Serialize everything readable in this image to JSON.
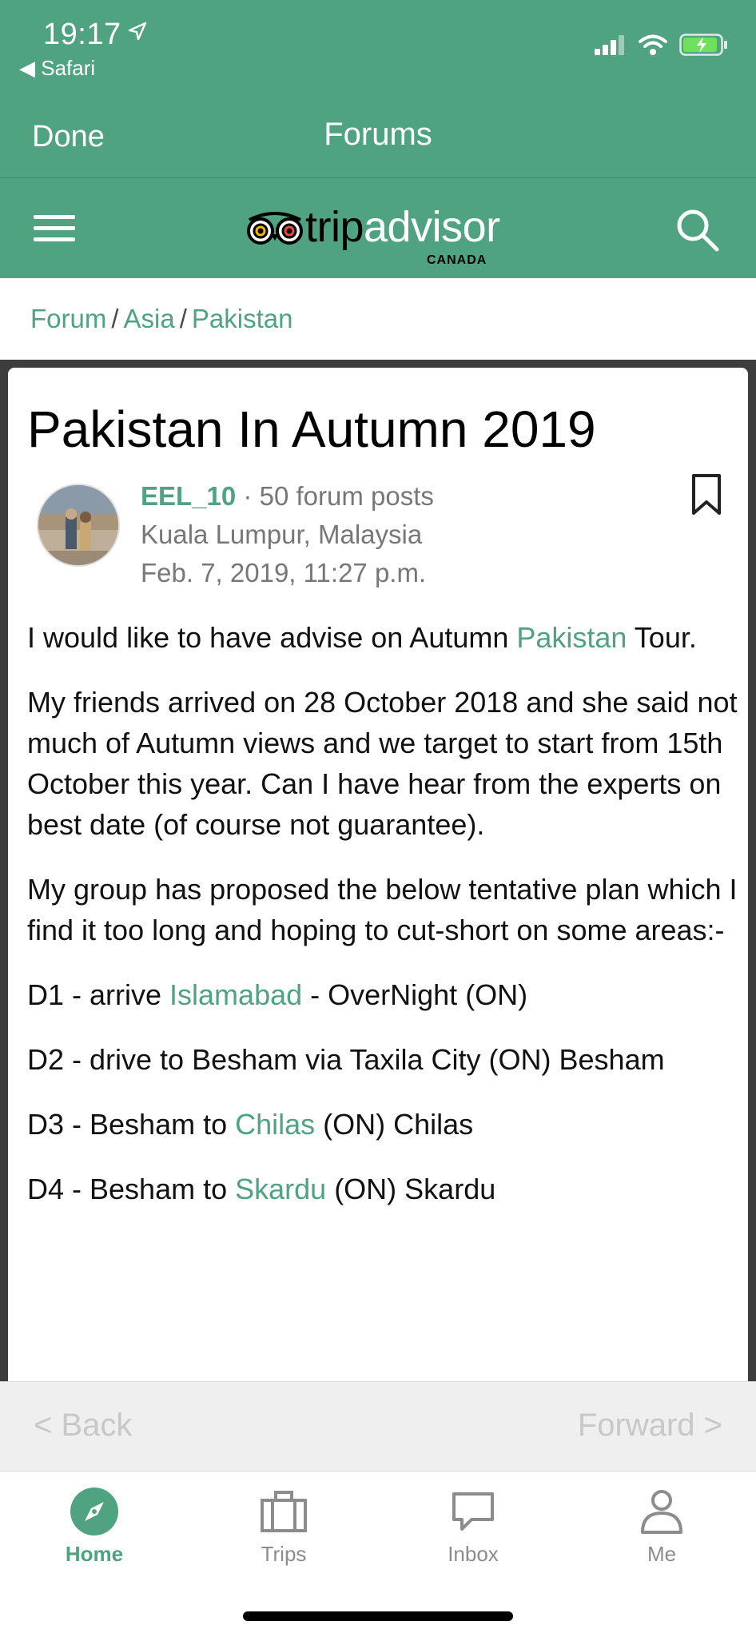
{
  "status_bar": {
    "time": "19:17",
    "back_app": "Safari"
  },
  "nav": {
    "done": "Done",
    "title": "Forums"
  },
  "header": {
    "logo_light": "trip",
    "logo_bold": "advisor",
    "logo_region": "CANADA"
  },
  "breadcrumb": {
    "items": [
      "Forum",
      "Asia",
      "Pakistan"
    ]
  },
  "post": {
    "title": "Pakistan In Autumn 2019",
    "author": "EEL_10",
    "post_count": "50 forum posts",
    "location": "Kuala Lumpur, Malaysia",
    "date": "Feb. 7, 2019, 11:27 p.m.",
    "p1_a": "I would like to have advise on Autumn ",
    "p1_link": "Pakistan",
    "p1_b": " Tour.",
    "p2": "My friends arrived on 28 October 2018 and she said not much of Autumn views and we target to start from 15th October this year. Can I have hear from the experts on best date (of course not guarantee).",
    "p3": "My group has proposed the below tentative plan which I find it too long and hoping to cut-short on some areas:-",
    "d1_a": "D1 - arrive ",
    "d1_link": "Islamabad",
    "d1_b": " - OverNight (ON)",
    "d2": "D2 - drive to Besham via Taxila City (ON) Besham",
    "d3_a": "D3 - Besham to ",
    "d3_link": "Chilas",
    "d3_b": " (ON) Chilas",
    "d4_a": "D4 - Besham to ",
    "d4_link": "Skardu",
    "d4_b": " (ON) Skardu"
  },
  "browser": {
    "back": "< Back",
    "forward": "Forward >"
  },
  "tabs": [
    {
      "label": "Home",
      "icon": "compass-icon",
      "active": true
    },
    {
      "label": "Trips",
      "icon": "briefcase-icon",
      "active": false
    },
    {
      "label": "Inbox",
      "icon": "chat-bubble-icon",
      "active": false
    },
    {
      "label": "Me",
      "icon": "person-icon",
      "active": false
    }
  ],
  "colors": {
    "brand_green": "#4fa381",
    "muted_text": "#777777",
    "disabled_text": "#c8c8c8"
  }
}
